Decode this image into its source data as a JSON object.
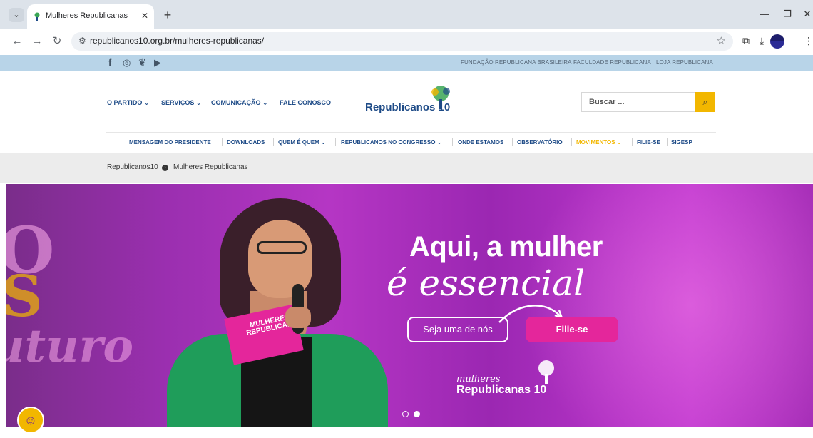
{
  "browser": {
    "tab_title": "Mulheres Republicanas | Republ...",
    "tab_close": "✕",
    "new_tab": "+",
    "url": "republicanos10.org.br/mulheres-republicanas/"
  },
  "topbar": {
    "links": [
      "FUNDAÇÃO REPUBLICANA BRASILEIRA",
      "FACULDADE REPUBLICANA",
      "LOJA REPUBLICANA"
    ]
  },
  "header": {
    "mainnav": [
      "O PARTIDO ⌄",
      "SERVIÇOS ⌄",
      "COMUNICAÇÃO ⌄",
      "FALE CONOSCO"
    ],
    "logo": "Republicanos 10",
    "search_placeholder": "Buscar ...",
    "subnav": [
      "MENSAGEM DO PRESIDENTE",
      "DOWNLOADS",
      "QUEM É QUEM ⌄",
      "REPUBLICANOS NO CONGRESSO ⌄",
      "ONDE ESTAMOS",
      "OBSERVATÓRIO",
      "MOVIMENTOS ⌄",
      "FILIE-SE",
      "SIGESP"
    ]
  },
  "breadcrumb": {
    "home": "Republicanos10",
    "current": "Mulheres Republicanas"
  },
  "hero": {
    "headline1": "Aqui, a mulher",
    "headline2": "é essencial",
    "cta_outline": "Seja uma de nós",
    "cta_filled": "Filie-se",
    "brand_small": "mulheres",
    "brand_big": "Republicanas 10",
    "card_text": "MULHERES REPUBLICANAS",
    "slides": 2,
    "active_slide": 2
  },
  "colors": {
    "brand_blue": "#1e4b87",
    "accent_yellow": "#f2b700",
    "pink": "#e4269b",
    "topbar": "#b8d4e8"
  }
}
